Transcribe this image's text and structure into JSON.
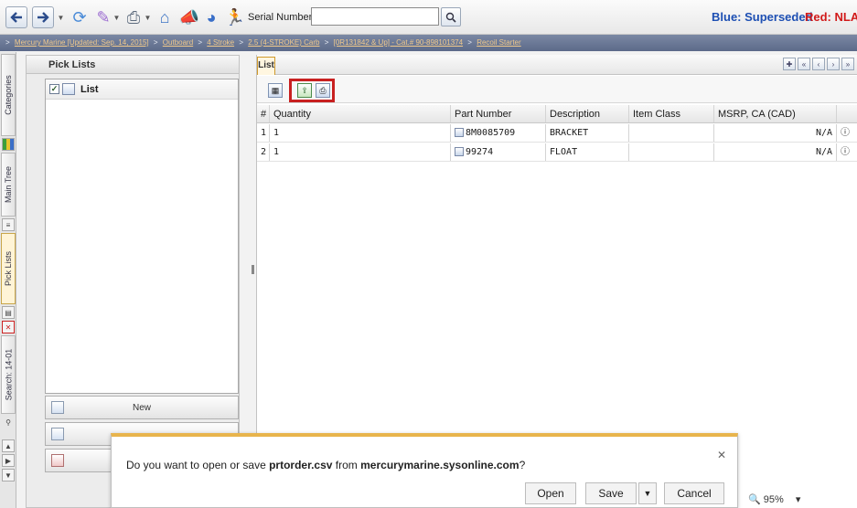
{
  "toolbar": {
    "serial_label": "Serial Number:",
    "serial_value": "",
    "legend_blue": "Blue: Superseded",
    "legend_red": "Red: NLA"
  },
  "breadcrumb": [
    "Mercury Marine [Updated: Sep. 14, 2015]",
    "Outboard",
    "4 Stroke",
    "2.5 (4-STROKE) Carb",
    "[0R131842 & Up] - Cat.# 90-898101374",
    "Recoil Starter"
  ],
  "side_tabs": {
    "categories": "Categories",
    "main_tree": "Main Tree",
    "pick_lists": "Pick Lists",
    "search": "Search: 14-01"
  },
  "pick_panel": {
    "title": "Pick Lists",
    "items": [
      "List"
    ],
    "new_button": "New"
  },
  "main": {
    "tab_label": "List",
    "columns": [
      "#",
      "Quantity",
      "Part Number",
      "Description",
      "Item Class",
      "MSRP, CA (CAD)"
    ],
    "rows": [
      {
        "num": "1",
        "qty": "1",
        "part": "8M0085709",
        "desc": "BRACKET",
        "item_class": "",
        "msrp": "N/A"
      },
      {
        "num": "2",
        "qty": "1",
        "part": "99274",
        "desc": "FLOAT",
        "item_class": "",
        "msrp": "N/A"
      }
    ]
  },
  "dialog": {
    "prefix": "Do you want to open or save ",
    "file": "prtorder.csv",
    "middle": " from ",
    "site": "mercurymarine.sysonline.com",
    "suffix": "?",
    "open": "Open",
    "save": "Save",
    "cancel": "Cancel"
  },
  "zoom": "95%",
  "colors": {
    "accent_orange": "#e8b44c",
    "blue_legend": "#1d4fb3",
    "red_legend": "#d11a1a",
    "highlight": "#c82020"
  }
}
